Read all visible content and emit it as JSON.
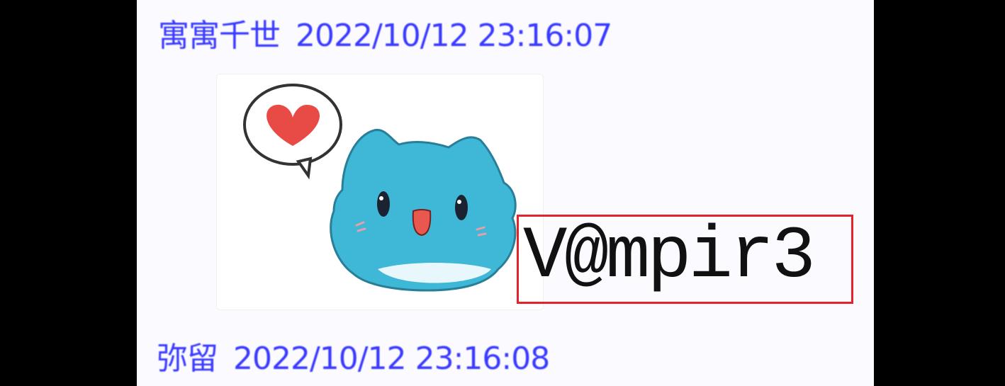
{
  "messages": [
    {
      "sender": "寓寓千世",
      "timestamp": "2022/10/12 23:16:07"
    },
    {
      "sender": "弥留",
      "timestamp": "2022/10/12 23:16:08"
    }
  ],
  "sticker": {
    "icon": "blue-cat-heart-sticker",
    "colors": {
      "cat_body": "#3fb7d6",
      "heart": "#e84a45",
      "mouth": "#e8584f",
      "eyes": "#1b2230"
    }
  },
  "highlight": {
    "text": "V@mpir3",
    "border_color": "#e2232b"
  },
  "colors": {
    "header_text": "#3a3aff",
    "background": "#000000",
    "panel": "#fbfbff"
  }
}
